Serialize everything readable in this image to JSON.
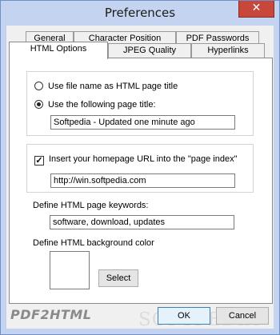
{
  "window": {
    "title": "Preferences",
    "close_glyph": "✕",
    "colors": {
      "frame": "#c4d3ef",
      "close_button": "#c7473b",
      "panel": "#ffffff",
      "client": "#f0f0f0"
    }
  },
  "tabs": {
    "back_row": [
      "General",
      "Character Position",
      "PDF Passwords"
    ],
    "front_row": [
      "HTML Options",
      "JPEG Quality",
      "Hyperlinks"
    ],
    "active": "HTML Options"
  },
  "title_group": {
    "option_filename": "Use file name as HTML page title",
    "option_following": "Use the following page title:",
    "selected": "Use the following page title:",
    "page_title_value": "Softpedia - Updated one minute ago"
  },
  "homepage_group": {
    "checkbox_label": "Insert your homepage URL into the \"page index\"",
    "checked": true,
    "check_glyph": "✓",
    "url_value": "http://win.softpedia.com"
  },
  "keywords": {
    "label": "Define HTML page keywords:",
    "value": "software, download, updates"
  },
  "background": {
    "label": "Define HTML background color",
    "color": "#ffffff",
    "select_label": "Select"
  },
  "footer": {
    "brand": "PDF2HTML",
    "ok_label": "OK",
    "cancel_label": "Cancel"
  }
}
